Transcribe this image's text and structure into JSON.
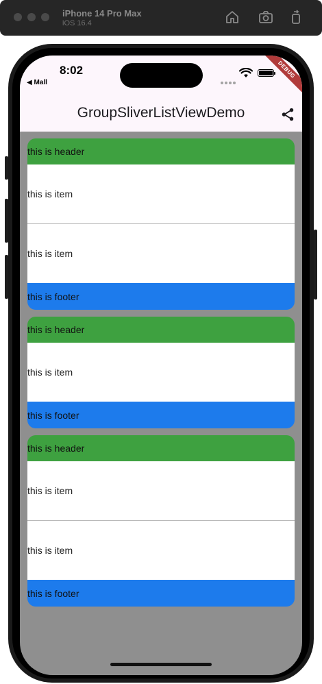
{
  "simulator": {
    "device_name": "iPhone 14 Pro Max",
    "os_version": "iOS 16.4",
    "toolbar_icons": [
      "home-icon",
      "screenshot-icon",
      "rotate-icon"
    ]
  },
  "status_bar": {
    "time": "8:02",
    "back_app": "◀ Mall"
  },
  "debug_banner": "DEBUG",
  "app_bar": {
    "title": "GroupSliverListViewDemo",
    "action_icon": "share-icon"
  },
  "colors": {
    "header": "#3ea140",
    "footer": "#1d7bec",
    "background": "#8f8f8f",
    "app_bar": "#fdf6fc"
  },
  "groups": [
    {
      "header": "this is header",
      "items": [
        "this is item",
        "this is item"
      ],
      "footer": "this is footer"
    },
    {
      "header": "this is header",
      "items": [
        "this is item"
      ],
      "footer": "this is footer"
    },
    {
      "header": "this is header",
      "items": [
        "this is item",
        "this is item"
      ],
      "footer": "this is footer"
    }
  ]
}
